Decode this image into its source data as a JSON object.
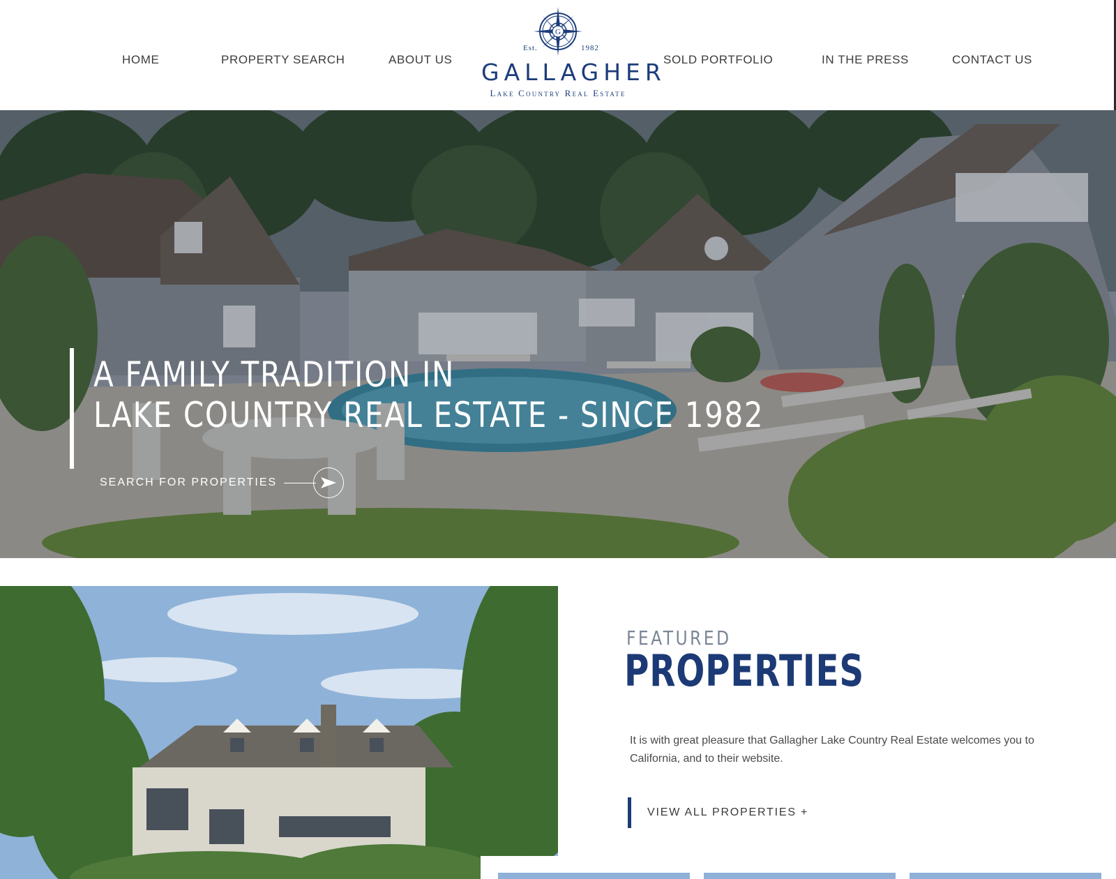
{
  "nav": {
    "left": [
      "HOME",
      "PROPERTY SEARCH",
      "ABOUT US"
    ],
    "right": [
      "SOLD PORTFOLIO",
      "IN THE PRESS",
      "CONTACT US"
    ]
  },
  "logo": {
    "est": "Est.",
    "year": "1982",
    "monogram": "G",
    "name": "GALLAGHER",
    "tagline": "Lake Country Real Estate"
  },
  "hero": {
    "line1": "A FAMILY TRADITION IN",
    "line2": "LAKE COUNTRY REAL ESTATE - SINCE 1982",
    "cta_label": "SEARCH FOR PROPERTIES",
    "cta_icon": "arrow-right-icon"
  },
  "featured": {
    "kicker": "FEATURED",
    "title": "PROPERTIES",
    "body": "It is with great pleasure that Gallagher Lake Country Real Estate welcomes you to California, and to their website.",
    "cta_label": "VIEW ALL PROPERTIES +"
  },
  "colors": {
    "brand_navy": "#1c3a75",
    "nav_text": "#3c3c3c",
    "kicker_gray": "#7a8696"
  }
}
